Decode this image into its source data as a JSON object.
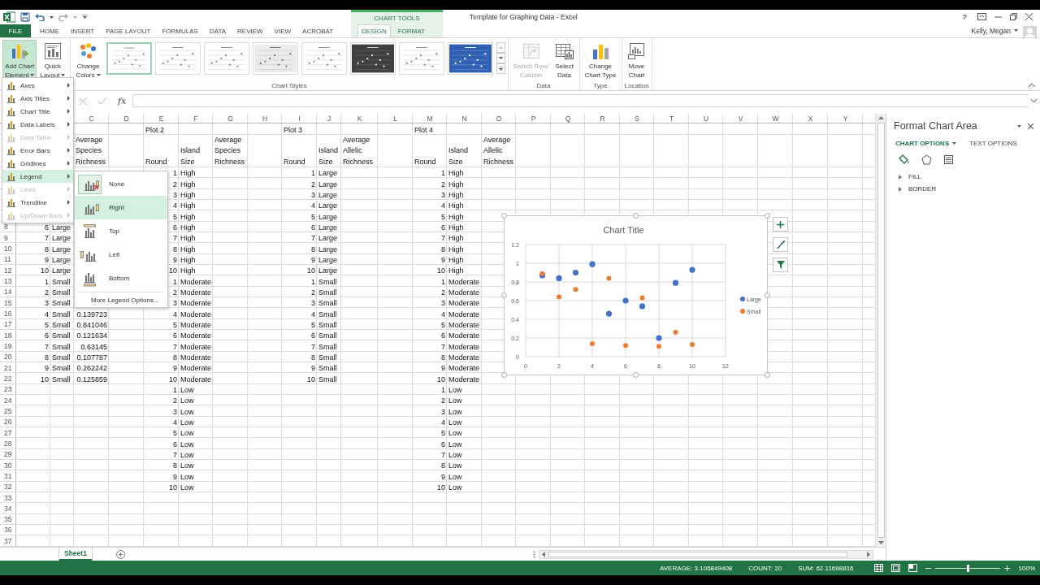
{
  "title_bar": {
    "context_label": "CHART TOOLS",
    "title": "Template for Graphing Data - Excel",
    "help": "?",
    "user": "Kelly, Megan"
  },
  "tabs": [
    {
      "label": "FILE",
      "kind": "file",
      "selected": false
    },
    {
      "label": "HOME",
      "kind": "main",
      "selected": false
    },
    {
      "label": "INSERT",
      "kind": "main",
      "selected": false
    },
    {
      "label": "PAGE LAYOUT",
      "kind": "main",
      "selected": false
    },
    {
      "label": "FORMULAS",
      "kind": "main",
      "selected": false
    },
    {
      "label": "DATA",
      "kind": "main",
      "selected": false
    },
    {
      "label": "REVIEW",
      "kind": "main",
      "selected": false
    },
    {
      "label": "VIEW",
      "kind": "main",
      "selected": false
    },
    {
      "label": "ACROBAT",
      "kind": "main",
      "selected": false
    },
    {
      "label": "DESIGN",
      "kind": "context",
      "selected": true
    },
    {
      "label": "FORMAT",
      "kind": "context",
      "selected": false
    }
  ],
  "ribbon": {
    "groups": [
      {
        "buttons": [
          {
            "lines": [
              "Add Chart",
              "Element"
            ],
            "dropdown": true,
            "pressed": true,
            "disabled": false
          },
          {
            "lines": [
              "Quick",
              "Layout"
            ],
            "dropdown": true,
            "pressed": false,
            "disabled": false
          }
        ]
      },
      {
        "label": "Chart Styles",
        "buttons": [
          {
            "lines": [
              "Change",
              "Colors"
            ],
            "dropdown": true,
            "pressed": false,
            "disabled": false
          }
        ],
        "gallery": [
          {
            "kind": "plain",
            "selected": true
          },
          {
            "kind": "plain",
            "selected": false
          },
          {
            "kind": "plain",
            "selected": false
          },
          {
            "kind": "shaded",
            "selected": false
          },
          {
            "kind": "plain",
            "selected": false
          },
          {
            "kind": "dark",
            "selected": false
          },
          {
            "kind": "plain",
            "selected": false
          },
          {
            "kind": "blue",
            "selected": false
          }
        ]
      },
      {
        "label": "Data",
        "buttons": [
          {
            "lines": [
              "Switch Row/",
              "Column"
            ],
            "dropdown": false,
            "pressed": false,
            "disabled": true
          },
          {
            "lines": [
              "Select",
              "Data"
            ],
            "dropdown": false,
            "pressed": false,
            "disabled": false
          }
        ]
      },
      {
        "label": "Type",
        "buttons": [
          {
            "lines": [
              "Change",
              "Chart Type"
            ],
            "dropdown": false,
            "pressed": false,
            "disabled": false
          }
        ]
      },
      {
        "label": "Location",
        "buttons": [
          {
            "lines": [
              "Move",
              "Chart"
            ],
            "dropdown": false,
            "pressed": false,
            "disabled": false
          }
        ]
      }
    ]
  },
  "formula_bar": {
    "function_label": "fx"
  },
  "chart_element_menu": {
    "items": [
      {
        "label": "Axes",
        "disabled": false,
        "selected": false
      },
      {
        "label": "Axis Titles",
        "disabled": false,
        "selected": false
      },
      {
        "label": "Chart Title",
        "disabled": false,
        "selected": false
      },
      {
        "label": "Data Labels",
        "disabled": false,
        "selected": false
      },
      {
        "label": "Data Table",
        "disabled": true,
        "selected": false
      },
      {
        "label": "Error Bars",
        "disabled": false,
        "selected": false
      },
      {
        "label": "Gridlines",
        "disabled": false,
        "selected": false
      },
      {
        "label": "Legend",
        "disabled": false,
        "selected": true
      },
      {
        "label": "Lines",
        "disabled": true,
        "selected": false
      },
      {
        "label": "Trendline",
        "disabled": false,
        "selected": false
      },
      {
        "label": "Up/Down Bars",
        "disabled": true,
        "selected": false
      }
    ]
  },
  "legend_submenu": {
    "items": [
      {
        "label": "None",
        "kind": "none",
        "current": true,
        "selected": false
      },
      {
        "label": "Right",
        "kind": "right",
        "current": false,
        "selected": true
      },
      {
        "label": "Top",
        "kind": "top",
        "current": false,
        "selected": false
      },
      {
        "label": "Left",
        "kind": "left",
        "current": false,
        "selected": false
      },
      {
        "label": "Bottom",
        "kind": "bottom",
        "current": false,
        "selected": false
      }
    ],
    "more": "More Legend Options..."
  },
  "sheet": {
    "column_headers": [
      "C",
      "D",
      "E",
      "F",
      "G",
      "H",
      "I",
      "J",
      "K",
      "L",
      "M",
      "N",
      "O",
      "P",
      "Q",
      "R",
      "S",
      "T",
      "U",
      "V",
      "W",
      "X",
      "Y"
    ],
    "rows": [
      {
        "labels": {
          "E": "Plot 2",
          "I": "Plot 3",
          "M": "Plot 4"
        }
      },
      {
        "wrap": true,
        "labels": {
          "C": "Average Species Richness",
          "E": "Round",
          "F": "Island Size",
          "G": "Average Species Richness",
          "I": "Round",
          "J": "Island Size",
          "K": "Average Allelic Richness",
          "M": "Round",
          "N": "Island Size",
          "O": "Average Allelic Richness"
        }
      },
      {
        "values": {
          "E": "1",
          "I": "1",
          "M": "1"
        },
        "labels": {
          "F": "High",
          "J": "Large",
          "N": "High"
        }
      },
      {
        "values": {
          "E": "2",
          "I": "2",
          "M": "2"
        },
        "labels": {
          "F": "High",
          "J": "Large",
          "N": "High"
        }
      },
      {
        "values": {
          "E": "3",
          "I": "3",
          "M": "3"
        },
        "labels": {
          "F": "High",
          "J": "Large",
          "N": "High"
        }
      },
      {
        "values": {
          "E": "4",
          "I": "4",
          "M": "4"
        },
        "labels": {
          "F": "High",
          "J": "Large",
          "N": "High"
        }
      },
      {
        "values": {
          "E": "5",
          "I": "5",
          "M": "5"
        },
        "labels": {
          "F": "High",
          "J": "Large",
          "N": "High"
        }
      },
      {
        "number": "8",
        "values": {
          "A": "6",
          "E": "6",
          "I": "6",
          "M": "6"
        },
        "labels": {
          "B": "Large",
          "F": "High",
          "J": "Large",
          "N": "High"
        }
      },
      {
        "number": "9",
        "values": {
          "A": "7",
          "E": "7",
          "I": "7",
          "M": "7"
        },
        "labels": {
          "B": "Large",
          "F": "High",
          "J": "Large",
          "N": "High"
        }
      },
      {
        "number": "10",
        "values": {
          "A": "8",
          "E": "8",
          "I": "8",
          "M": "8"
        },
        "labels": {
          "B": "Large",
          "F": "High",
          "J": "Large",
          "N": "High"
        }
      },
      {
        "number": "11",
        "values": {
          "A": "9",
          "E": "9",
          "I": "9",
          "M": "9"
        },
        "labels": {
          "B": "Large",
          "F": "High",
          "J": "Large",
          "N": "High"
        }
      },
      {
        "number": "12",
        "values": {
          "A": "10",
          "E": "10",
          "I": "10",
          "M": "10"
        },
        "labels": {
          "B": "Large",
          "F": "High",
          "J": "Large",
          "N": "High"
        }
      },
      {
        "number": "13",
        "values": {
          "A": "1",
          "E": "1",
          "I": "1",
          "M": "1"
        },
        "labels": {
          "B": "Small",
          "F": "Moderate",
          "J": "Small",
          "N": "Moderate"
        }
      },
      {
        "number": "14",
        "values": {
          "A": "2",
          "E": "2",
          "I": "2",
          "M": "2"
        },
        "labels": {
          "B": "Small",
          "F": "Moderate",
          "J": "Small",
          "N": "Moderate"
        }
      },
      {
        "number": "15",
        "values": {
          "A": "3",
          "E": "3",
          "I": "3",
          "M": "3"
        },
        "labels": {
          "B": "Small",
          "F": "Moderate",
          "J": "Small",
          "N": "Moderate"
        }
      },
      {
        "number": "16",
        "values": {
          "A": "4",
          "C": "0.139723",
          "E": "4",
          "I": "4",
          "M": "4"
        },
        "labels": {
          "B": "Small",
          "F": "Moderate",
          "J": "Small",
          "N": "Moderate"
        }
      },
      {
        "number": "17",
        "values": {
          "A": "5",
          "C": "0.841046",
          "E": "5",
          "I": "5",
          "M": "5"
        },
        "labels": {
          "B": "Small",
          "F": "Moderate",
          "J": "Small",
          "N": "Moderate"
        }
      },
      {
        "number": "18",
        "values": {
          "A": "6",
          "C": "0.121634",
          "E": "6",
          "I": "6",
          "M": "6"
        },
        "labels": {
          "B": "Small",
          "F": "Moderate",
          "J": "Small",
          "N": "Moderate"
        }
      },
      {
        "number": "19",
        "values": {
          "A": "7",
          "C": "0.63145",
          "E": "7",
          "I": "7",
          "M": "7"
        },
        "labels": {
          "B": "Small",
          "F": "Moderate",
          "J": "Small",
          "N": "Moderate"
        }
      },
      {
        "number": "20",
        "values": {
          "A": "8",
          "C": "0.107787",
          "E": "8",
          "I": "8",
          "M": "8"
        },
        "labels": {
          "B": "Small",
          "F": "Moderate",
          "J": "Small",
          "N": "Moderate"
        }
      },
      {
        "number": "21",
        "values": {
          "A": "9",
          "C": "0.262242",
          "E": "9",
          "I": "9",
          "M": "9"
        },
        "labels": {
          "B": "Small",
          "F": "Moderate",
          "J": "Small",
          "N": "Moderate"
        }
      },
      {
        "number": "22",
        "values": {
          "A": "10",
          "C": "0.125859",
          "E": "10",
          "I": "10",
          "M": "10"
        },
        "labels": {
          "B": "Small",
          "F": "Moderate",
          "J": "Small",
          "N": "Moderate"
        }
      },
      {
        "number": "23",
        "values": {
          "E": "1",
          "M": "1"
        },
        "labels": {
          "F": "Low",
          "N": "Low"
        }
      },
      {
        "number": "24",
        "values": {
          "E": "2",
          "M": "2"
        },
        "labels": {
          "F": "Low",
          "N": "Low"
        }
      },
      {
        "number": "25",
        "values": {
          "E": "3",
          "M": "3"
        },
        "labels": {
          "F": "Low",
          "N": "Low"
        }
      },
      {
        "number": "26",
        "values": {
          "E": "4",
          "M": "4"
        },
        "labels": {
          "F": "Low",
          "N": "Low"
        }
      },
      {
        "number": "27",
        "values": {
          "E": "5",
          "M": "5"
        },
        "labels": {
          "F": "Low",
          "N": "Low"
        }
      },
      {
        "number": "28",
        "values": {
          "E": "6",
          "M": "6"
        },
        "labels": {
          "F": "Low",
          "N": "Low"
        }
      },
      {
        "number": "29",
        "values": {
          "E": "7",
          "M": "7"
        },
        "labels": {
          "F": "Low",
          "N": "Low"
        }
      },
      {
        "number": "30",
        "values": {
          "E": "8",
          "M": "8"
        },
        "labels": {
          "F": "Low",
          "N": "Low"
        }
      },
      {
        "number": "31",
        "values": {
          "E": "9",
          "M": "9"
        },
        "labels": {
          "F": "Low",
          "N": "Low"
        }
      },
      {
        "number": "32",
        "values": {
          "E": "10",
          "M": "10"
        },
        "labels": {
          "F": "Low",
          "N": "Low"
        }
      },
      {
        "number": "33"
      },
      {
        "number": "34"
      },
      {
        "number": "35"
      },
      {
        "number": "36"
      },
      {
        "number": "37"
      }
    ]
  },
  "chart": {
    "chart_data": {
      "type": "scatter",
      "title": "Chart Title",
      "x": [
        1,
        2,
        3,
        4,
        5,
        6,
        7,
        8,
        9,
        10
      ],
      "series": [
        {
          "name": "Large",
          "color": "#4472c4",
          "values": [
            0.87,
            0.84,
            0.9,
            0.99,
            0.46,
            0.6,
            0.54,
            0.2,
            0.79,
            0.93
          ]
        },
        {
          "name": "Small",
          "color": "#ed7d31",
          "values": [
            0.89,
            0.64,
            0.72,
            0.14,
            0.84,
            0.12,
            0.63,
            0.11,
            0.26,
            0.13
          ]
        }
      ],
      "xlim": [
        0,
        12
      ],
      "ylim": [
        0,
        1.2
      ],
      "xticks": [
        0,
        2,
        4,
        6,
        8,
        10,
        12
      ],
      "yticks": [
        0,
        0.2,
        0.4,
        0.6,
        0.8,
        1,
        1.2
      ],
      "grid": true,
      "legend": "right"
    }
  },
  "format_pane": {
    "title": "Format Chart Area",
    "tabs": [
      {
        "label": "CHART OPTIONS",
        "selected": true,
        "dropdown": true
      },
      {
        "label": "TEXT OPTIONS",
        "selected": false,
        "dropdown": false
      }
    ],
    "sections": [
      {
        "label": "FILL",
        "expanded": false
      },
      {
        "label": "BORDER",
        "expanded": false
      }
    ]
  },
  "sheet_tabs": [
    {
      "label": "Sheet1",
      "selected": true
    }
  ],
  "status_bar": {
    "items": [
      "AVERAGE: 3.105849408",
      "COUNT: 20",
      "SUM: 62.11698816"
    ],
    "zoom_slider": {
      "level": 0.5
    },
    "zoom": "100%"
  }
}
